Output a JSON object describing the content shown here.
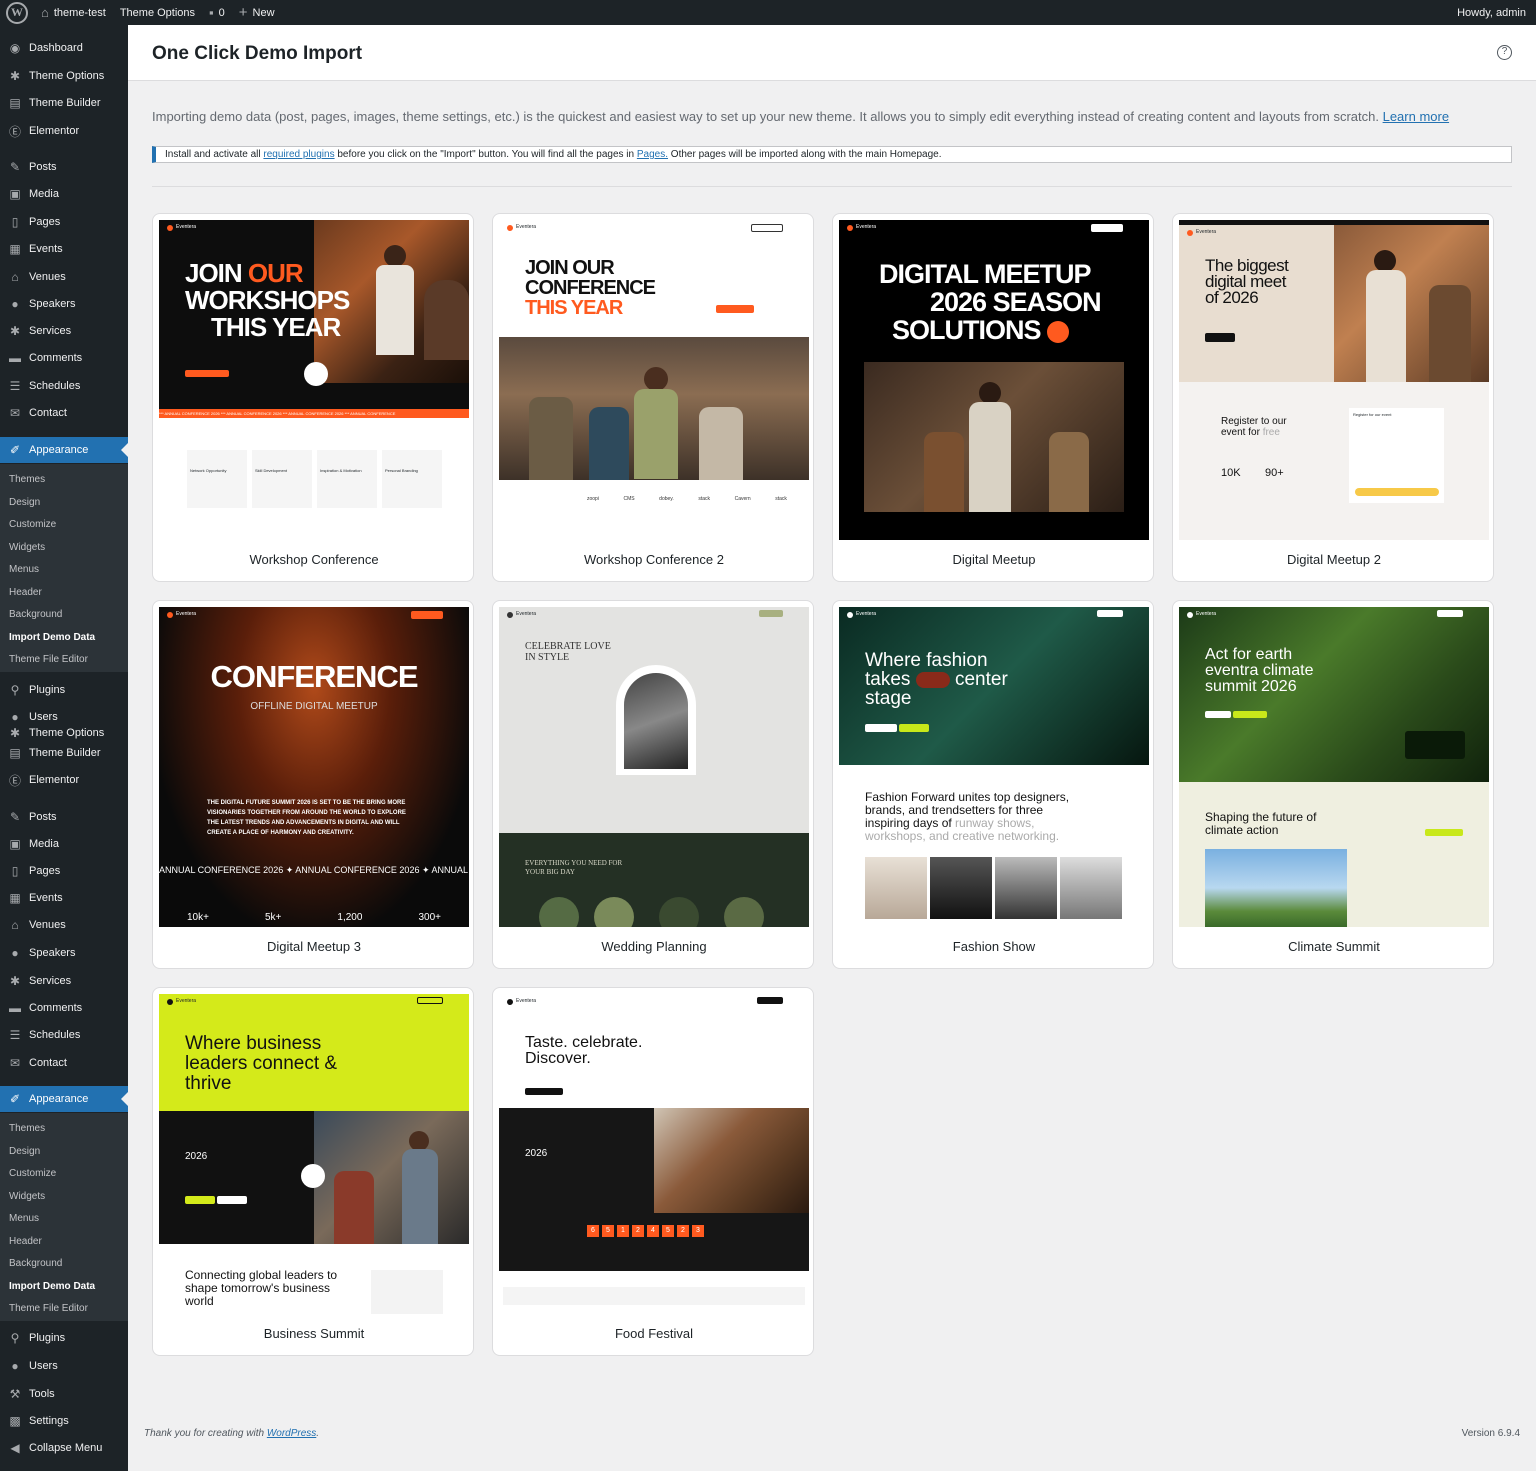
{
  "adminbar": {
    "site_name": "theme-test",
    "theme_options": "Theme Options",
    "comments_count": "0",
    "new_label": "New",
    "howdy": "Howdy, admin"
  },
  "sidebar": {
    "items": [
      {
        "label": "Dashboard",
        "icon": "dashboard-icon"
      },
      {
        "label": "Theme Options",
        "icon": "gear-icon"
      },
      {
        "label": "Theme Builder",
        "icon": "builder-icon"
      },
      {
        "label": "Elementor",
        "icon": "elementor-icon"
      },
      {
        "label": "Posts",
        "icon": "pin-icon"
      },
      {
        "label": "Media",
        "icon": "media-icon"
      },
      {
        "label": "Pages",
        "icon": "page-icon"
      },
      {
        "label": "Events",
        "icon": "calendar-icon"
      },
      {
        "label": "Venues",
        "icon": "venue-icon"
      },
      {
        "label": "Speakers",
        "icon": "user-icon"
      },
      {
        "label": "Services",
        "icon": "gear-icon"
      },
      {
        "label": "Comments",
        "icon": "comment-icon"
      },
      {
        "label": "Schedules",
        "icon": "schedule-icon"
      },
      {
        "label": "Contact",
        "icon": "mail-icon"
      },
      {
        "label": "Appearance",
        "icon": "brush-icon"
      }
    ],
    "appearance_sub": [
      "Themes",
      "Design",
      "Customize",
      "Widgets",
      "Menus",
      "Header",
      "Background",
      "Import Demo Data",
      "Theme File Editor"
    ],
    "items_b": [
      {
        "label": "Plugins",
        "icon": "plugin-icon"
      },
      {
        "label": "Users",
        "icon": "user-icon"
      },
      {
        "label": "Theme Options",
        "icon": "gear-icon"
      },
      {
        "label": "Theme Builder",
        "icon": "builder-icon"
      },
      {
        "label": "Elementor",
        "icon": "elementor-icon"
      },
      {
        "label": "Posts",
        "icon": "pin-icon"
      },
      {
        "label": "Media",
        "icon": "media-icon"
      },
      {
        "label": "Pages",
        "icon": "page-icon"
      },
      {
        "label": "Events",
        "icon": "calendar-icon"
      },
      {
        "label": "Venues",
        "icon": "venue-icon"
      },
      {
        "label": "Speakers",
        "icon": "user-icon"
      },
      {
        "label": "Services",
        "icon": "gear-icon"
      },
      {
        "label": "Comments",
        "icon": "comment-icon"
      },
      {
        "label": "Schedules",
        "icon": "schedule-icon"
      },
      {
        "label": "Contact",
        "icon": "mail-icon"
      },
      {
        "label": "Appearance",
        "icon": "brush-icon"
      }
    ],
    "items_c": [
      {
        "label": "Plugins",
        "icon": "plugin-icon"
      },
      {
        "label": "Users",
        "icon": "user-icon"
      },
      {
        "label": "Tools",
        "icon": "wrench-icon"
      },
      {
        "label": "Settings",
        "icon": "settings-icon"
      },
      {
        "label": "Collapse Menu",
        "icon": "collapse-icon"
      }
    ]
  },
  "page": {
    "title": "One Click Demo Import",
    "intro": "Importing demo data (post, pages, images, theme settings, etc.) is the quickest and easiest way to set up your new theme. It allows you to simply edit everything instead of creating content and layouts from scratch.",
    "learn_more": "Learn more",
    "notice_pre": "Install and activate all",
    "notice_link1": "required plugins",
    "notice_mid": "before you click on the \"Import\" button. You will find all the pages in",
    "notice_link2": "Pages.",
    "notice_post": "Other pages will be imported along with the main Homepage."
  },
  "demos": [
    {
      "name": "Workshop Conference"
    },
    {
      "name": "Workshop Conference 2"
    },
    {
      "name": "Digital Meetup"
    },
    {
      "name": "Digital Meetup 2"
    },
    {
      "name": "Digital Meetup 3"
    },
    {
      "name": "Wedding Planning"
    },
    {
      "name": "Fashion Show"
    },
    {
      "name": "Climate Summit"
    },
    {
      "name": "Business Summit"
    },
    {
      "name": "Food Festival"
    }
  ],
  "thumbs": {
    "t1": {
      "l1": "JOIN ",
      "l1b": "OUR",
      "l2": "WORKSHOPS",
      "l3": "THIS YEAR",
      "ticker": "*** ANNUAL CONFERENCE 2026 *** ANNUAL CONFERENCE 2026 *** ANNUAL CONFERENCE 2026 *** ANNUAL CONFERENCE",
      "f1": "Network Opportunity",
      "f2": "Skill Development",
      "f3": "Inspiration & Motivation",
      "f4": "Personal Branding",
      "brand": "Eventera"
    },
    "t2": {
      "l1": "JOIN OUR",
      "l2": "CONFERENCE",
      "l3": "THIS YEAR",
      "logos": [
        "zoopi",
        "CMS",
        "dobey.",
        "stack",
        "Cavern",
        "stack"
      ],
      "brand": "Eventera"
    },
    "t3": {
      "l1": "DIGITAL MEETUP",
      "l2": "2026 SEASON",
      "l3": "SOLUTIONS",
      "brand": "Eventera"
    },
    "t4": {
      "l1": "The biggest",
      "l2": "digital meet",
      "l3": "of 2026",
      "reg1": "Register to our",
      "reg2": "event for ",
      "reg2b": "free",
      "s1": "10K",
      "s2": "90+",
      "form_title": "Register for our event",
      "brand": "Eventera"
    },
    "t5": {
      "l1": "CONFERENCE",
      "l2": "OFFLINE DIGITAL MEETUP",
      "p1": "THE DIGITAL FUTURE SUMMIT 2026 IS SET TO BE THE BRING MORE",
      "p2": "VISIONARIES TOGETHER FROM AROUND THE WORLD TO EXPLORE",
      "p3": "THE LATEST TRENDS AND ADVANCEMENTS IN DIGITAL AND WILL",
      "p4": "CREATE A PLACE OF HARMONY AND CREATIVITY.",
      "ticker": "ANNUAL CONFERENCE 2026 ✦ ANNUAL CONFERENCE 2026 ✦ ANNUAL",
      "n1": "10k+",
      "n2": "5k+",
      "n3": "1,200",
      "n4": "300+",
      "brand": "Eventera"
    },
    "t6": {
      "l1": "CELEBRATE LOVE",
      "l2": "IN STYLE",
      "l3": "EVERYTHING YOU NEED FOR",
      "l4": "YOUR BIG DAY",
      "brand": "Eventera"
    },
    "t7": {
      "l1": "Where fashion",
      "l2": "takes",
      "l2b": "center",
      "l3": "stage",
      "p1": "Fashion Forward unites top designers,",
      "p2": "brands, and trendsetters for three",
      "p3": "inspiring days of ",
      "p3b": "runway shows,",
      "p4": "workshops, and creative networking.",
      "brand": "Eventera"
    },
    "t8": {
      "l1": "Act for earth",
      "l2": "eventra climate",
      "l3": "summit 2026",
      "s1": "Shaping the future of",
      "s2": "climate action",
      "brand": "Eventera"
    },
    "t9": {
      "l1": "Where business",
      "l2": "leaders connect &",
      "l3": "thrive",
      "year": "2026",
      "c1": "Connecting global leaders to",
      "c2": "shape tomorrow's business",
      "c3": "world",
      "brand": "Eventera"
    },
    "t10": {
      "l1": "Taste. celebrate.",
      "l2": "Discover.",
      "year": "2026",
      "digits": [
        "6",
        "5",
        "1",
        "2",
        "4",
        "5",
        "2",
        "3"
      ],
      "brand": "Eventera"
    }
  },
  "footer": {
    "thanks": "Thank you for creating with ",
    "wp_link": "WordPress",
    "version": "Version 6.9.4"
  }
}
